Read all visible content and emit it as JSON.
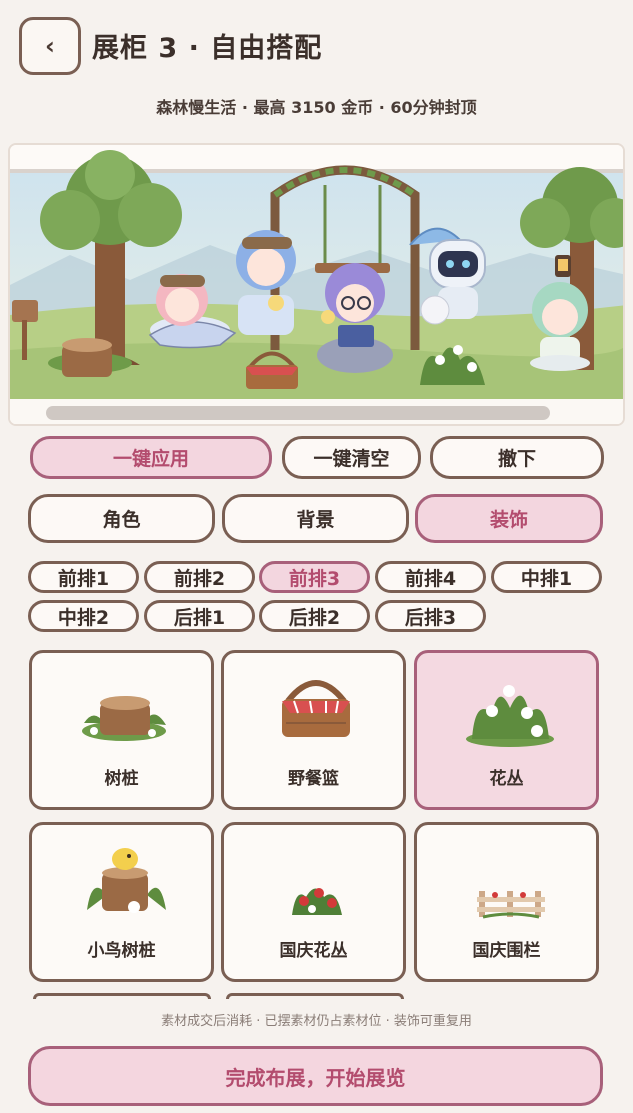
{
  "header": {
    "back_icon": "‹",
    "title": "展柜 3 · 自由搭配",
    "subtitle": "森林慢生活 · 最高 3150 金币 · 60分钟封顶"
  },
  "actions": {
    "apply": "一键应用",
    "clear": "一键清空",
    "remove": "撤下"
  },
  "categories": {
    "items": [
      "角色",
      "背景",
      "装饰"
    ],
    "selected": "装饰"
  },
  "slots": {
    "items": [
      "前排1",
      "前排2",
      "前排3",
      "前排4",
      "中排1",
      "中排2",
      "后排1",
      "后排2",
      "后排3"
    ],
    "selected": "前排3"
  },
  "decorations": {
    "items": [
      {
        "label": "树桩",
        "icon": "tree-stump"
      },
      {
        "label": "野餐篮",
        "icon": "picnic-basket"
      },
      {
        "label": "花丛",
        "icon": "flower-bush"
      },
      {
        "label": "小鸟树桩",
        "icon": "bird-stump"
      },
      {
        "label": "国庆花丛",
        "icon": "red-flower-bush"
      },
      {
        "label": "国庆围栏",
        "icon": "fence"
      }
    ],
    "selected": "花丛"
  },
  "footnote": "素材成交后消耗 · 已摆素材仍占素材位 · 装饰可重复用",
  "primary_button": "完成布展，开始展览",
  "colors": {
    "accent_pink": "#b34c6e",
    "active_bg": "#f3d6df",
    "border_brown": "#7a5f53",
    "page_bg": "#f6f2ee"
  }
}
